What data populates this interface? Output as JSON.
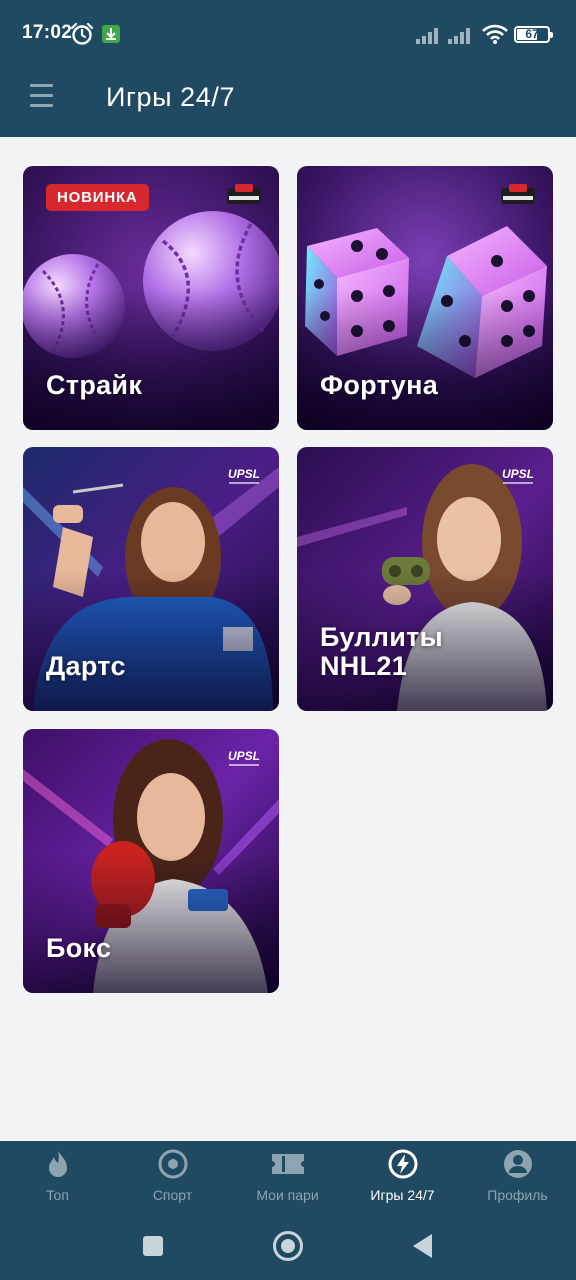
{
  "status_bar": {
    "time": "17:02",
    "battery": "67",
    "battery_level": 0.67
  },
  "header": {
    "title": "Игры 24/7"
  },
  "games": [
    {
      "title": "Страйк",
      "badge": "НОВИНКА",
      "logo": "nardball-logo"
    },
    {
      "title": "Фортуна",
      "badge": "",
      "logo": "nardball-logo"
    },
    {
      "title": "Дартс",
      "badge": "",
      "logo": "upsl-logo"
    },
    {
      "title": "Буллиты NHL21",
      "badge": "",
      "logo": "upsl-logo"
    },
    {
      "title": "Бокс",
      "badge": "",
      "logo": "upsl-logo"
    }
  ],
  "bottom_nav": [
    {
      "label": "Топ",
      "icon": "flame-icon",
      "active": false
    },
    {
      "label": "Спорт",
      "icon": "target-icon",
      "active": false
    },
    {
      "label": "Мои пари",
      "icon": "ticket-icon",
      "active": false
    },
    {
      "label": "Игры 24/7",
      "icon": "lightning-icon",
      "active": true
    },
    {
      "label": "Профиль",
      "icon": "profile-icon",
      "active": false
    }
  ],
  "colors": {
    "header_bg": "#1f4a61",
    "page_bg": "#f2f3f4",
    "badge_red": "#d7282f",
    "nav_inactive": "#8ea4b1",
    "nav_active": "#ffffff"
  }
}
